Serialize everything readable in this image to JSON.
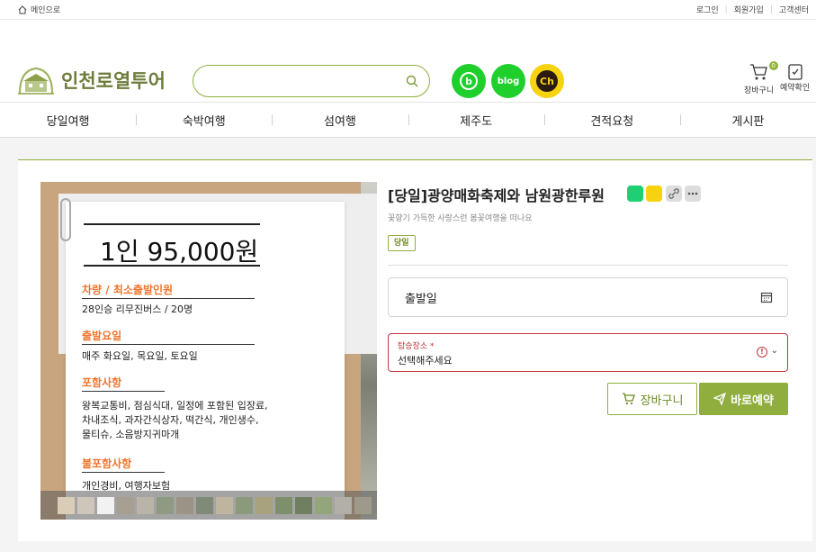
{
  "topbar": {
    "home_label": "메인으로",
    "login": "로그인",
    "signup": "회원가입",
    "support": "고객센터"
  },
  "logo": {
    "text": "인천로열투어"
  },
  "search": {
    "placeholder": "",
    "value": ""
  },
  "social": {
    "band": "b",
    "blog": "blog",
    "channel": "Ch"
  },
  "util": {
    "cart_label": "장바구니",
    "cart_count": "0",
    "reservation_label": "예약확인"
  },
  "nav": {
    "items": [
      "당일여행",
      "숙박여행",
      "섬여행",
      "제주도",
      "견적요청",
      "게시판"
    ]
  },
  "product": {
    "title": "[당일]광양매화축제와 남원광한루원",
    "subtitle": "꽃향기 가득한 사랑스런 봄꽃여행을 떠나요",
    "tag": "당일",
    "date_label": "출발일",
    "pickup_label": "탑승장소 *",
    "pickup_value": "선택해주세요",
    "cart_button": "장바구니",
    "buy_button": "바로예약"
  },
  "poster": {
    "price": "1인 95,000원",
    "sections": [
      {
        "title": "차량 / 최소출발인원",
        "lines": [
          "28인승 리무진버스 / 20명"
        ]
      },
      {
        "title": "출발요일",
        "lines": [
          "매주 화요일, 목요일, 토요일"
        ]
      },
      {
        "title": "포함사항",
        "lines": [
          "왕복교통비, 점심식대, 일정에 포함된 입장료,",
          "차내조식, 과자간식상자, 떡간식, 개인생수,",
          "물티슈, 소음방지귀마개"
        ]
      },
      {
        "title": "불포함사항",
        "lines": [
          "개인경비, 여행자보험"
        ]
      }
    ]
  },
  "colors": {
    "accent": "#8fae3e",
    "error": "#c2363f",
    "poster_heading": "#f0742b",
    "naver_green": "#1fcf2c",
    "kakao_yellow": "#f6d20f"
  }
}
